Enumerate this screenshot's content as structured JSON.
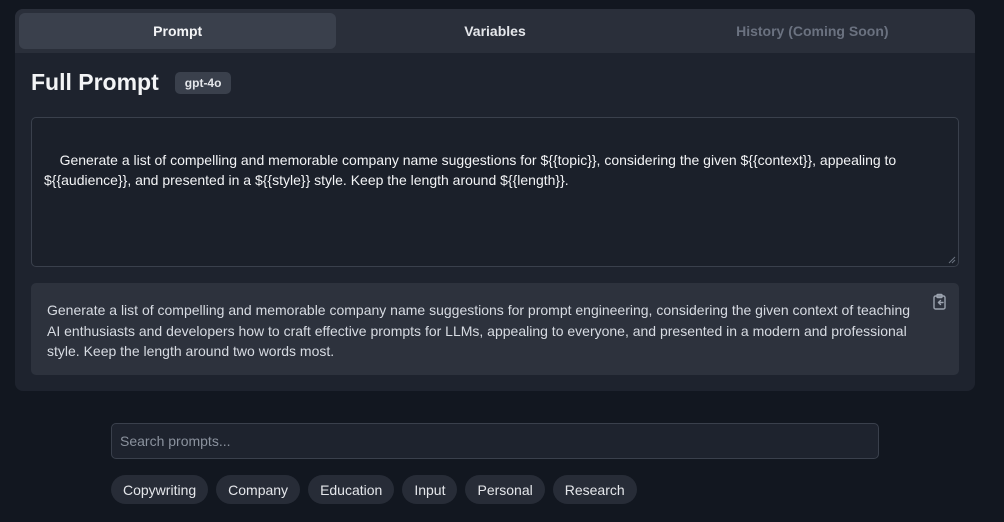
{
  "tabs": [
    {
      "label": "Prompt",
      "state": "active"
    },
    {
      "label": "Variables",
      "state": "normal"
    },
    {
      "label": "History (Coming Soon)",
      "state": "disabled"
    }
  ],
  "heading": {
    "title": "Full Prompt",
    "model": "gpt-4o"
  },
  "template": {
    "text": "Generate a list of compelling and memorable company name suggestions for ${{topic}}, considering the given ${{context}}, appealing to ${{audience}}, and presented in a ${{style}} style. Keep the length around ${{length}}."
  },
  "output": {
    "text": "Generate a list of compelling and memorable company name suggestions for prompt engineering, considering the given context of teaching AI enthusiasts and developers how to craft effective prompts for LLMs, appealing to everyone, and presented in a modern and professional style. Keep the length around two words most.",
    "copy_icon": "clipboard-copy-icon"
  },
  "search": {
    "placeholder": "Search prompts...",
    "value": ""
  },
  "tags": [
    "Copywriting",
    "Company",
    "Education",
    "Input",
    "Personal",
    "Research"
  ],
  "colors": {
    "background": "#121720",
    "panel": "#1e232e",
    "tab_bar": "#2a2f3a",
    "active_tab": "#3a404c",
    "output_bg": "#2d323d"
  }
}
